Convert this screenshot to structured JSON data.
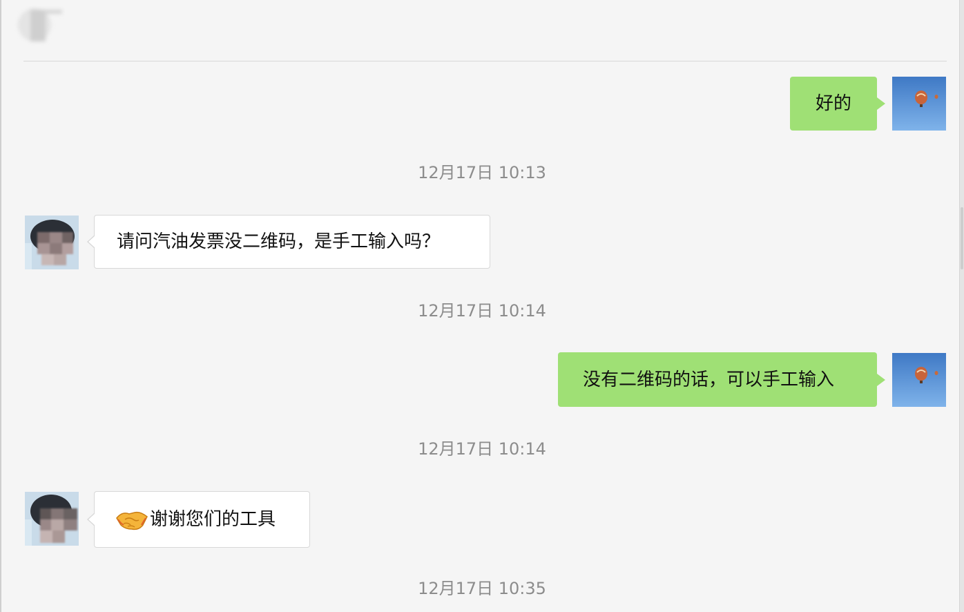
{
  "messages": [
    {
      "sender": "me",
      "text": "好的"
    },
    {
      "sender": "other",
      "text": "请问汽油发票没二维码，是手工输入吗？"
    },
    {
      "sender": "me",
      "text": "没有二维码的话，可以手工输入"
    },
    {
      "sender": "other",
      "emoji": "handshake-icon",
      "text": "谢谢您们的工具"
    }
  ],
  "timestamps": [
    "12月17日 10:13",
    "12月17日 10:14",
    "12月17日 10:14",
    "12月17日 10:35"
  ],
  "colors": {
    "background": "#f5f5f5",
    "my_bubble": "#9fe075",
    "their_bubble": "#ffffff",
    "timestamp_text": "#8c8c8c"
  }
}
